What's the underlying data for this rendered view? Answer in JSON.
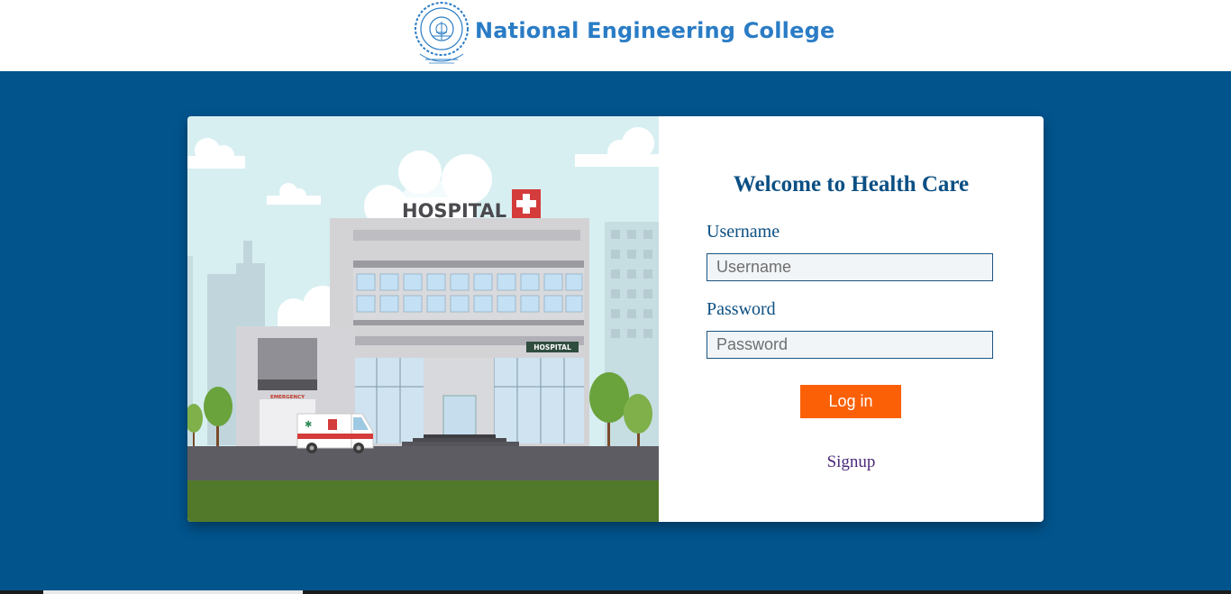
{
  "header": {
    "college_name": "National Engineering College",
    "logo_icon": "college-seal-icon"
  },
  "illustration": {
    "hospital_sign": "HOSPITAL",
    "small_sign": "HOSPITAL",
    "emergency_label": "EMERGENCY",
    "icons": [
      "hospital-cross-icon",
      "ambulance-icon",
      "tree-icon",
      "cloud-icon"
    ]
  },
  "login": {
    "title": "Welcome to Health Care",
    "username_label": "Username",
    "username_placeholder": "Username",
    "password_label": "Password",
    "password_placeholder": "Password",
    "login_button": "Log in",
    "signup_link": "Signup"
  },
  "colors": {
    "page_background": "#02548d",
    "brand_text": "#2a7cc5",
    "title_text": "#0b4f83",
    "login_button": "#fb6007",
    "signup_link": "#4b2a7a"
  }
}
